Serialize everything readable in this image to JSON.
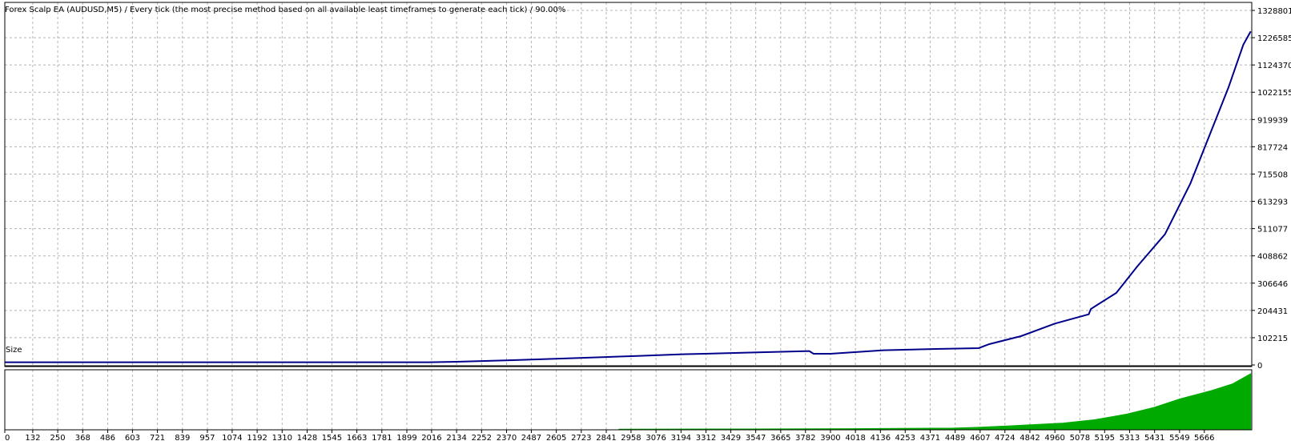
{
  "header": {
    "title": "Forex Scalp EA (AUDUSD,M5) / Every tick (the most precise method based on all available least timeframes to generate each tick) / 90.00%"
  },
  "colors": {
    "balance_line": "#00008b",
    "size_fill": "#00aa00",
    "grid": "#b4b4b4",
    "frame": "#000000",
    "background": "#ffffff"
  },
  "chart_data": [
    {
      "type": "line",
      "title": "Forex Scalp EA (AUDUSD,M5) / Every tick (the most precise method based on all available least timeframes to generate each tick) / 90.00%",
      "xlim": [
        0,
        5890
      ],
      "ylim": [
        0,
        1328801
      ],
      "yticks": [
        0,
        102215,
        204431,
        306646,
        408862,
        511077,
        613293,
        715508,
        817724,
        919939,
        1022155,
        1124370,
        1226585,
        1328801
      ],
      "grid": true,
      "series": [
        {
          "x": [
            0,
            500,
            1000,
            1500,
            2000,
            2134,
            2400,
            2700,
            3000,
            3200,
            3500,
            3800,
            3820,
            3900,
            4150,
            4400,
            4600,
            4650,
            4800,
            4960,
            5120,
            5130,
            5250,
            5350,
            5480,
            5600,
            5700,
            5780,
            5850,
            5885
          ],
          "y": [
            10000,
            10000,
            10000,
            10000,
            10000,
            12000,
            18000,
            26000,
            34000,
            40000,
            46000,
            52000,
            42000,
            42000,
            55000,
            60000,
            63000,
            78000,
            108000,
            155000,
            190000,
            210000,
            270000,
            370000,
            490000,
            680000,
            880000,
            1040000,
            1200000,
            1250000
          ]
        }
      ]
    },
    {
      "type": "area",
      "ylabel": "Size",
      "xlim": [
        0,
        5890
      ],
      "ylim": [
        0,
        1
      ],
      "xticks": [
        0,
        132,
        250,
        368,
        486,
        603,
        721,
        839,
        957,
        1074,
        1192,
        1310,
        1428,
        1545,
        1663,
        1781,
        1899,
        2016,
        2134,
        2252,
        2370,
        2487,
        2605,
        2723,
        2841,
        2958,
        3076,
        3194,
        3312,
        3429,
        3547,
        3665,
        3782,
        3900,
        4018,
        4136,
        4253,
        4371,
        4489,
        4607,
        4724,
        4842,
        4960,
        5078,
        5195,
        5313,
        5431,
        5549,
        5666
      ],
      "grid": true,
      "series": [
        {
          "x": [
            0,
            2900,
            2901,
            3500,
            4000,
            4480,
            4600,
            4800,
            5000,
            5150,
            5300,
            5430,
            5550,
            5700,
            5800,
            5885
          ],
          "y": [
            0,
            0,
            0.01,
            0.015,
            0.02,
            0.03,
            0.045,
            0.08,
            0.12,
            0.18,
            0.28,
            0.4,
            0.55,
            0.7,
            0.82,
            1.0
          ]
        }
      ]
    }
  ]
}
